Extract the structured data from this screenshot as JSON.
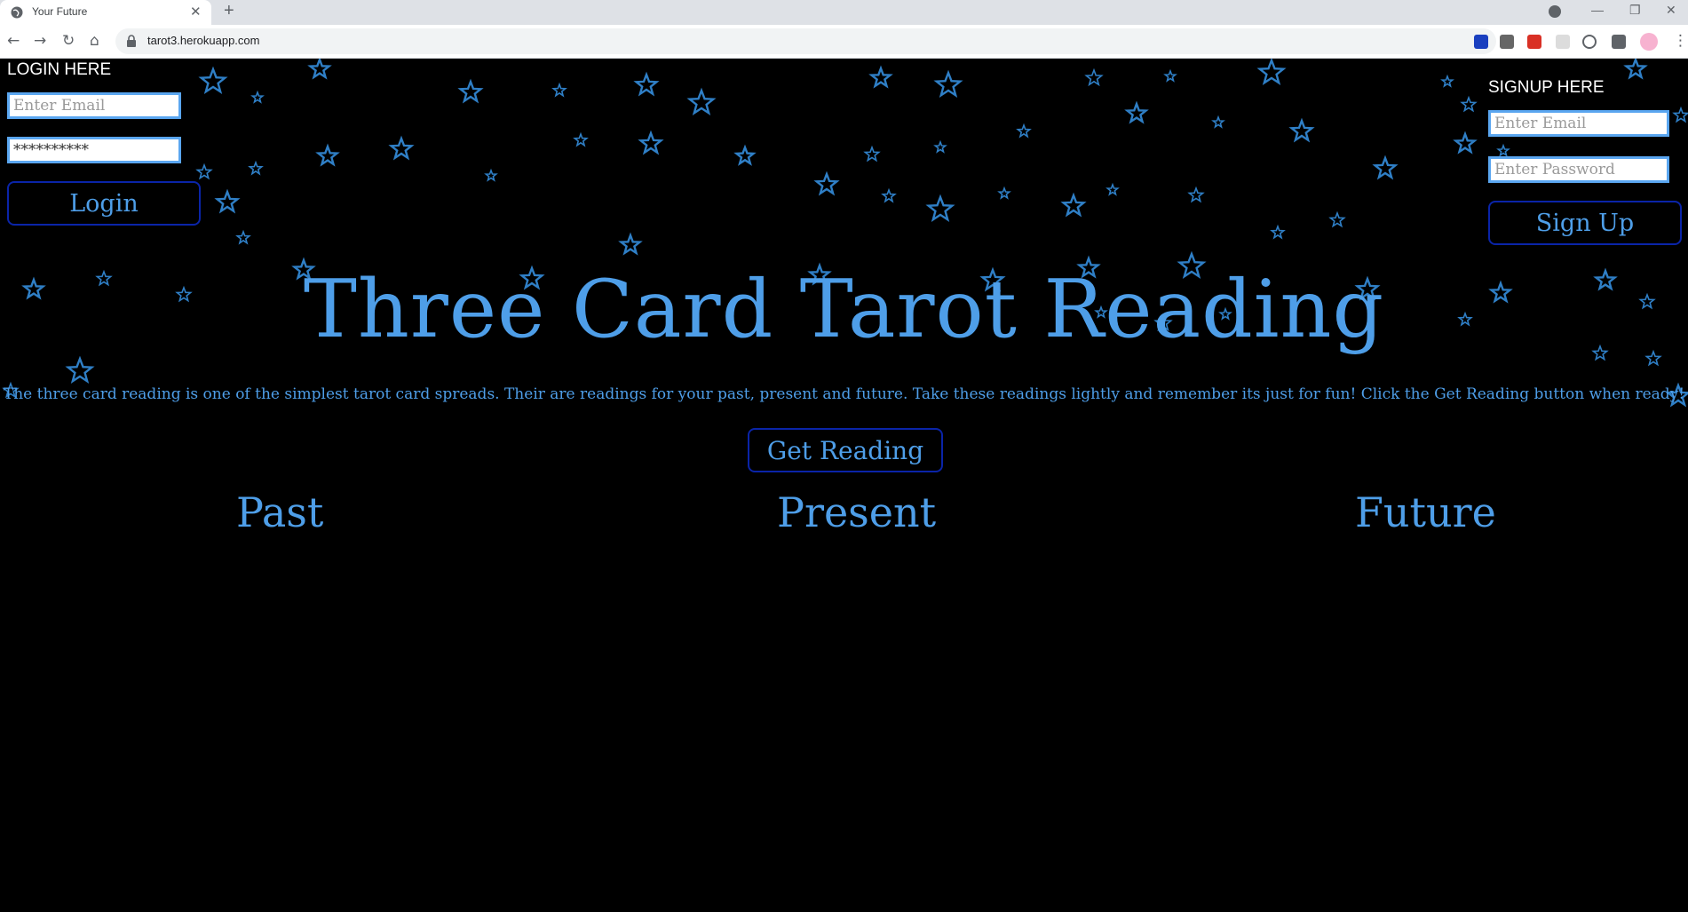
{
  "browser": {
    "tab_title": "Your Future",
    "url": "tarot3.herokuapp.com"
  },
  "login": {
    "heading": "LOGIN HERE",
    "email_placeholder": "Enter Email",
    "password_value": "**********",
    "button_label": "Login"
  },
  "signup": {
    "heading": "SIGNUP HERE",
    "email_placeholder": "Enter Email",
    "password_placeholder": "Enter Password",
    "button_label": "Sign Up"
  },
  "main": {
    "title": "Three Card Tarot Reading",
    "description": "The three card reading is one of the simplest tarot card spreads. Their are readings for your past, present and future. Take these readings lightly and remember its just for fun! Click the Get Reading button when ready!",
    "get_reading_label": "Get Reading",
    "columns": [
      "Past",
      "Present",
      "Future"
    ]
  },
  "colors": {
    "accent": "#4e9ee8",
    "background": "#000000",
    "button_border": "#0a24a8",
    "moon": "#1e90ff",
    "star_stroke": "#2f7fc6"
  }
}
